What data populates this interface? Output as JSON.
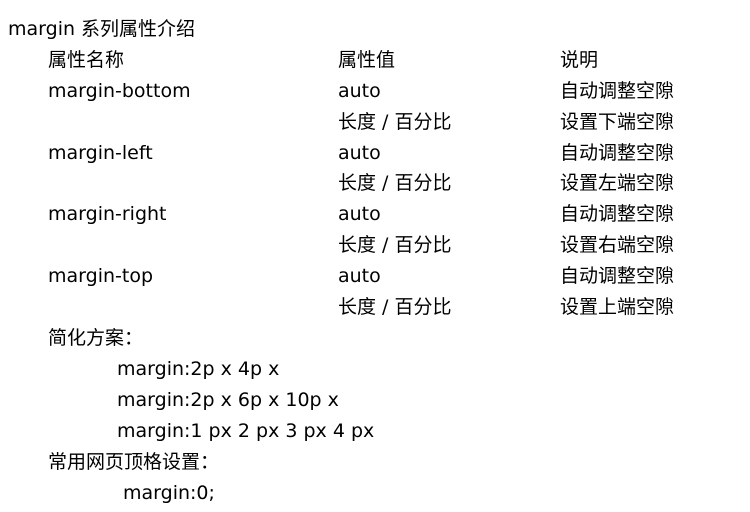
{
  "title": "margin 系列属性介绍",
  "table": {
    "headers": [
      "属性名称",
      "属性值",
      "说明"
    ],
    "rows": [
      [
        "margin-bottom",
        "auto",
        "自动调整空隙"
      ],
      [
        "",
        "长度 / 百分比",
        "设置下端空隙"
      ],
      [
        "margin-left",
        "auto",
        "自动调整空隙"
      ],
      [
        "",
        "长度 / 百分比",
        "设置左端空隙"
      ],
      [
        "margin-right",
        "auto",
        "自动调整空隙"
      ],
      [
        "",
        "长度 / 百分比",
        "设置右端空隙"
      ],
      [
        "margin-top",
        "auto",
        "自动调整空隙"
      ],
      [
        "",
        "长度 / 百分比",
        "设置上端空隙"
      ]
    ]
  },
  "shorthand": {
    "heading": "简化方案：",
    "examples": [
      "margin:2p x 4p x",
      "margin:2p x 6p x 10p x",
      "margin:1 px 2 px 3 px 4 px"
    ]
  },
  "common": {
    "heading": "常用网页顶格设置：",
    "example": "margin:0;"
  }
}
